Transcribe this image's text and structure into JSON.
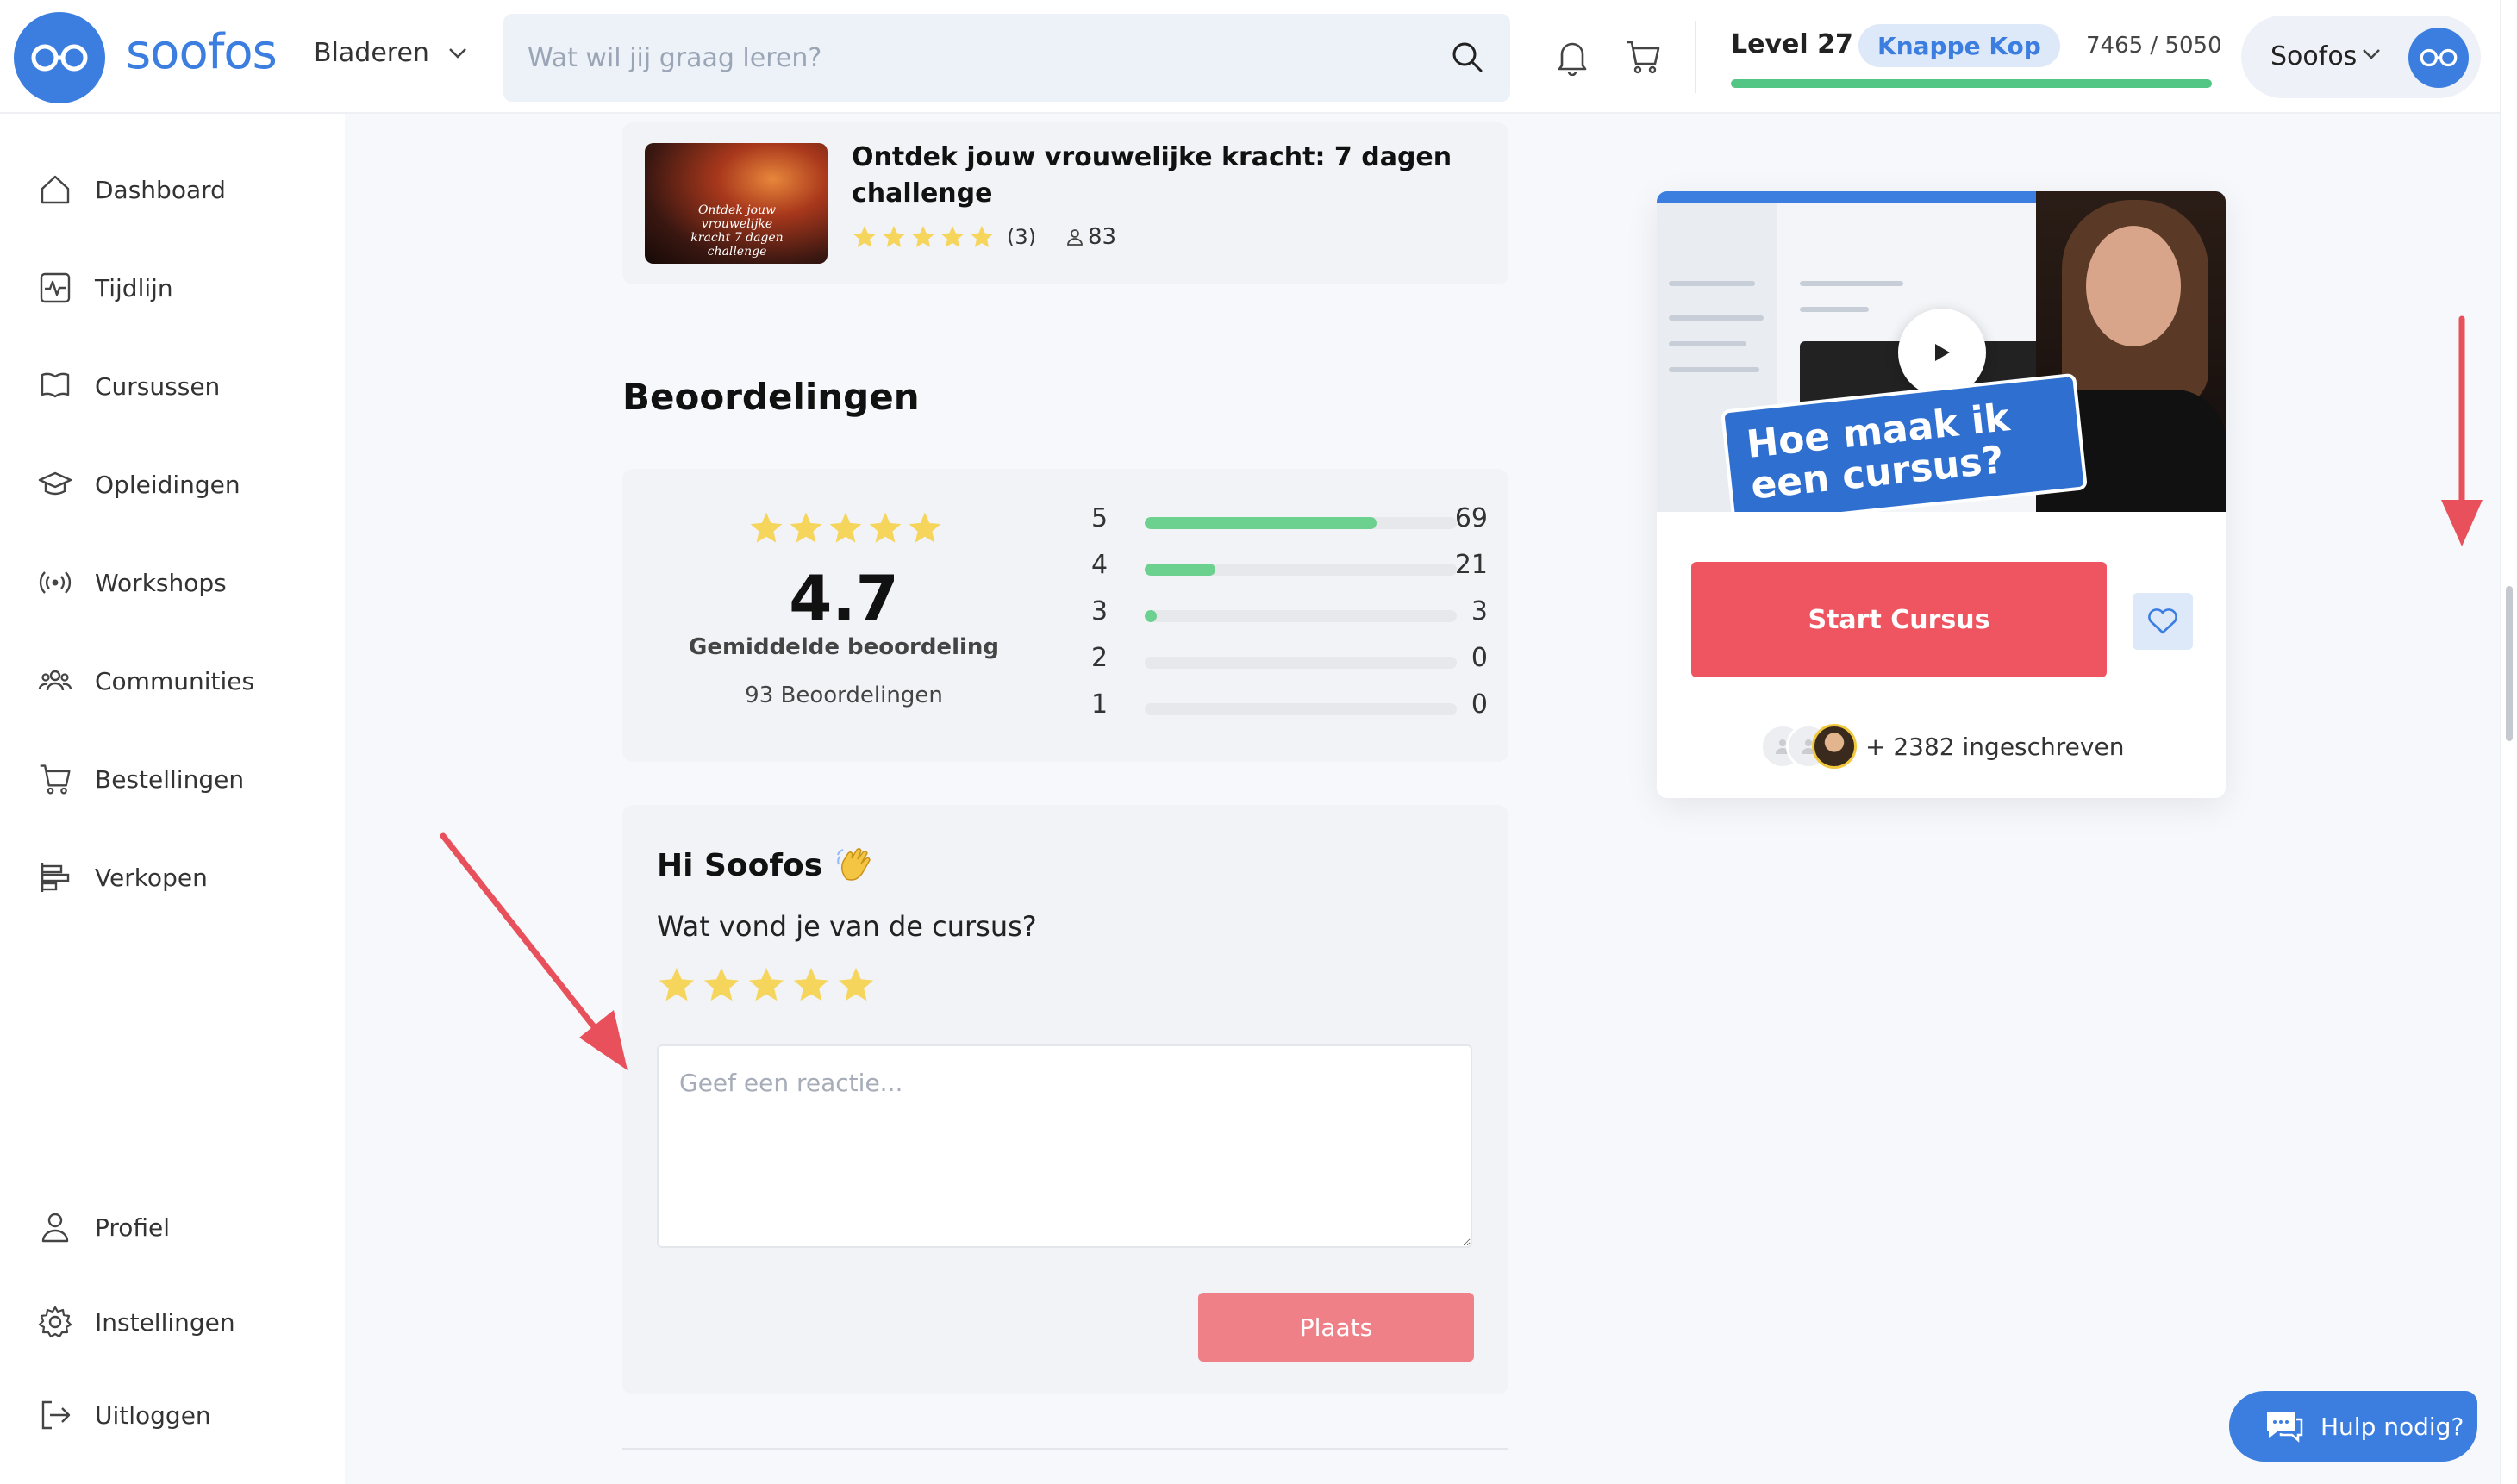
{
  "header": {
    "logo_text": "soofos",
    "browse_label": "Bladeren",
    "search_placeholder": "Wat wil jij graag leren?",
    "level_label": "Level 27",
    "badge_label": "Knappe Kop",
    "xp_text": "7465 / 5050",
    "xp_fraction": 1.0,
    "user_name": "Soofos"
  },
  "sidebar": {
    "top_items": [
      {
        "label": "Dashboard",
        "icon": "home-icon"
      },
      {
        "label": "Tijdlijn",
        "icon": "activity-icon"
      },
      {
        "label": "Cursussen",
        "icon": "book-icon"
      },
      {
        "label": "Opleidingen",
        "icon": "graduation-cap-icon"
      },
      {
        "label": "Workshops",
        "icon": "broadcast-icon"
      },
      {
        "label": "Communities",
        "icon": "users-icon"
      },
      {
        "label": "Bestellingen",
        "icon": "cart-icon"
      },
      {
        "label": "Verkopen",
        "icon": "chart-bars-icon"
      }
    ],
    "bottom_items": [
      {
        "label": "Profiel",
        "icon": "user-icon"
      },
      {
        "label": "Instellingen",
        "icon": "gear-icon"
      },
      {
        "label": "Uitloggen",
        "icon": "logout-icon"
      }
    ]
  },
  "related_course": {
    "title": "Ontdek jouw vrouwelijke kracht: 7 dagen challenge",
    "thumb_text": "Ontdek jouw vrouwelijke kracht 7 dagen challenge",
    "rating_count": "(3)",
    "students": "83"
  },
  "reviews": {
    "section_title": "Beoordelingen",
    "average": "4.7",
    "average_label": "Gemiddelde beoordeling",
    "total_label": "93 Beoordelingen",
    "distribution": [
      {
        "stars": "5",
        "count": "69",
        "fraction": 0.742
      },
      {
        "stars": "4",
        "count": "21",
        "fraction": 0.226
      },
      {
        "stars": "3",
        "count": "3",
        "fraction": 0.032
      },
      {
        "stars": "2",
        "count": "0",
        "fraction": 0
      },
      {
        "stars": "1",
        "count": "0",
        "fraction": 0
      }
    ]
  },
  "review_form": {
    "greeting": "Hi Soofos",
    "question": "Wat vond je van de cursus?",
    "placeholder": "Geef een reactie...",
    "submit_label": "Plaats"
  },
  "course_panel": {
    "video_title": "Hoe maak ik een cursus?",
    "start_label": "Start Cursus",
    "enrolled_text": "+ 2382 ingeschreven"
  },
  "help": {
    "label": "Hulp nodig?"
  },
  "colors": {
    "brand": "#3c7ee0",
    "start": "#ee5560",
    "bar": "#6cd08f",
    "arrow": "#e8505b"
  }
}
